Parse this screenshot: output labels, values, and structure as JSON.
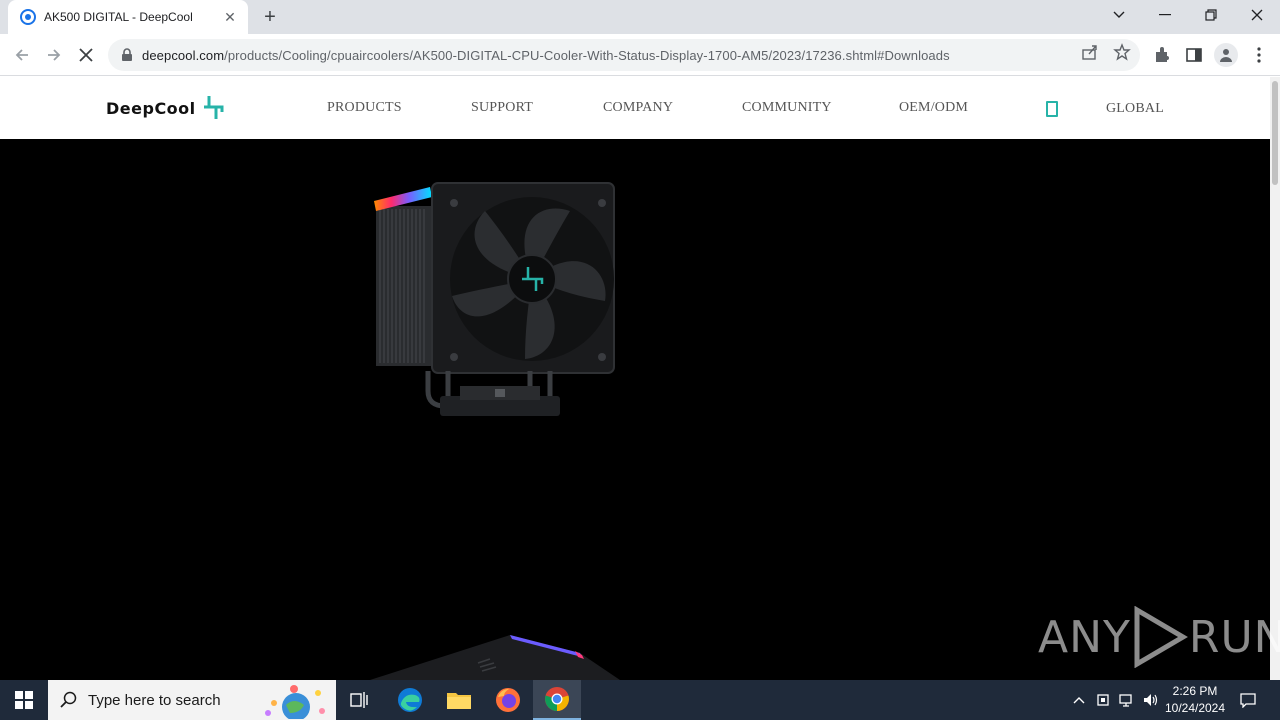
{
  "browser": {
    "tab": {
      "title": "AK500 DIGITAL - DeepCool",
      "close": "✕"
    },
    "new_tab": "+",
    "url_host": "deepcool.com",
    "url_path": "/products/Cooling/cpuaircoolers/AK500-DIGITAL-CPU-Cooler-With-Status-Display-1700-AM5/2023/17236.shtml#Downloads"
  },
  "site": {
    "logo_text": "DeepCool",
    "nav": [
      "PRODUCTS",
      "SUPPORT",
      "COMPANY",
      "COMMUNITY",
      "OEM/ODM",
      "GLOBAL"
    ]
  },
  "watermark": {
    "left": "ANY",
    "right": "RUN"
  },
  "taskbar": {
    "search_placeholder": "Type here to search",
    "time": "2:26 PM",
    "date": "10/24/2024"
  },
  "colors": {
    "brand_accent": "#27b3a8",
    "hero_bg": "#000000",
    "taskbar_bg": "#1f2a3a"
  }
}
